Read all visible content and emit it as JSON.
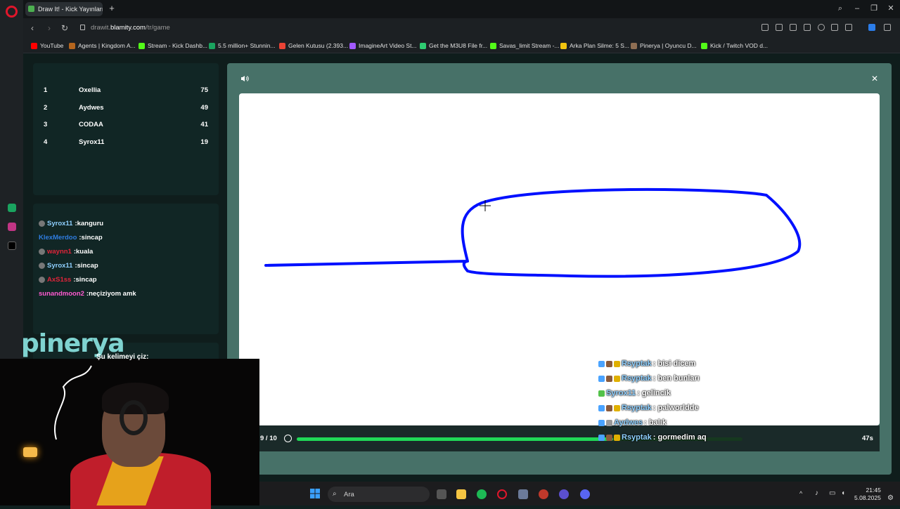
{
  "browser": {
    "tab_title": "Draw It! - Kick Yayınları İç",
    "url_prefix": "drawit.",
    "url_domain": "blamity.com",
    "url_path": "/tr/game",
    "bookmarks": [
      {
        "label": "YouTube",
        "color": "#ff0000"
      },
      {
        "label": "Agents | Kingdom A...",
        "color": "#b5651d"
      },
      {
        "label": "Stream - Kick Dashb...",
        "color": "#53fc18"
      },
      {
        "label": "5.5 million+ Stunnin...",
        "color": "#1aa35f"
      },
      {
        "label": "Gelen Kutusu (2.393...",
        "color": "#ea4335"
      },
      {
        "label": "ImagineArt Video St...",
        "color": "#a259ff"
      },
      {
        "label": "Get the M3U8 File fr...",
        "color": "#2ecc71"
      },
      {
        "label": "Savas_limit Stream -...",
        "color": "#53fc18"
      },
      {
        "label": "Arka Plan Silme: 5 S...",
        "color": "#f1c40f"
      },
      {
        "label": "Pinerya | Oyuncu D...",
        "color": "#8e6e53"
      },
      {
        "label": "Kick / Twitch VOD d...",
        "color": "#53fc18"
      }
    ]
  },
  "leaderboard": [
    {
      "rank": "1",
      "name": "Oxellia",
      "score": "75"
    },
    {
      "rank": "2",
      "name": "Aydwes",
      "score": "49"
    },
    {
      "rank": "3",
      "name": "CODAA",
      "score": "41"
    },
    {
      "rank": "4",
      "name": "Syrox11",
      "score": "19"
    }
  ],
  "chat": [
    {
      "user": "Syrox11",
      "msg": ":kanguru",
      "color": "#8fd0ff",
      "avatar": true
    },
    {
      "user": "KlexMerdoo",
      "msg": ":sincap",
      "color": "#2f7de1",
      "avatar": false
    },
    {
      "user": "waynn1",
      "msg": ":kuala",
      "color": "#e0243a",
      "avatar": true
    },
    {
      "user": "Syrox11",
      "msg": ":sincap",
      "color": "#8fd0ff",
      "avatar": true
    },
    {
      "user": "AxS1ss",
      "msg": ":sincap",
      "color": "#e0243a",
      "avatar": true
    },
    {
      "user": "sunandmoon2",
      "msg": ":neçiziyom amk",
      "color": "#ff5ad1",
      "avatar": false
    }
  ],
  "word_prompt": "Şu kelimeyi çiz:",
  "webcam_brand": "pinerya",
  "game": {
    "round": "9 / 10",
    "time_left": "47s",
    "progress": 0.71,
    "overlay_chat": [
      {
        "user": "Rsyptak",
        "msg": ": bisi dicem"
      },
      {
        "user": "Rsyptak",
        "msg": ": ben bunları"
      },
      {
        "user": "Syrox11",
        "msg": ": gelincik"
      },
      {
        "user": "Rsyptak",
        "msg": ": palworldde"
      },
      {
        "user": "Aydwes",
        "msg": ": balık"
      },
      {
        "user": "Rsyptak",
        "msg": ": gormedim aq"
      }
    ]
  },
  "taskbar": {
    "search_placeholder": "Ara",
    "time": "21:45",
    "date": "5.08.2025"
  },
  "colors": {
    "stroke": "#0010ff",
    "progress": "#20d957",
    "game_bg": "#477168"
  }
}
